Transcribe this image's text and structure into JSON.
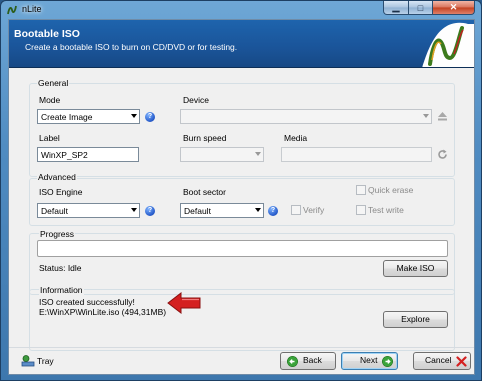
{
  "window": {
    "title": "nLite"
  },
  "banner": {
    "title": "Bootable ISO",
    "subtitle": "Create a bootable ISO to burn on CD/DVD or for testing."
  },
  "general": {
    "group_label": "General",
    "mode_label": "Mode",
    "mode_value": "Create Image",
    "device_label": "Device",
    "device_value": "",
    "label_label": "Label",
    "label_value": "WinXP_SP2",
    "burn_speed_label": "Burn speed",
    "burn_speed_value": "",
    "media_label": "Media",
    "media_value": ""
  },
  "advanced": {
    "group_label": "Advanced",
    "iso_engine_label": "ISO Engine",
    "iso_engine_value": "Default",
    "boot_sector_label": "Boot sector",
    "boot_sector_value": "Default",
    "verify_label": "Verify",
    "quick_erase_label": "Quick erase",
    "test_write_label": "Test write"
  },
  "progress": {
    "group_label": "Progress",
    "percent": 0,
    "status": "Status: Idle",
    "make_iso_label": "Make ISO"
  },
  "information": {
    "group_label": "Information",
    "line1": "ISO created successfully!",
    "line2": "E:\\WinXP\\WinLite.iso (494,31MB)",
    "explore_label": "Explore"
  },
  "footer": {
    "tray_label": "Tray",
    "back_label": "Back",
    "next_label": "Next",
    "cancel_label": "Cancel"
  },
  "colors": {
    "banner": "#1a5499",
    "accent_green": "#3aa33a",
    "accent_red": "#d42020"
  }
}
